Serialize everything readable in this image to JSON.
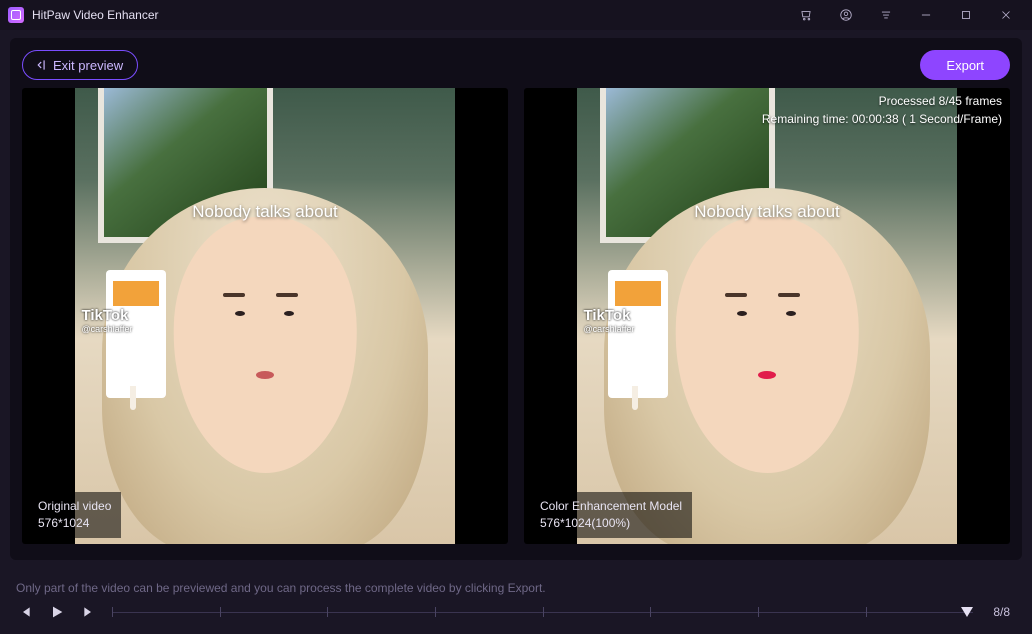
{
  "app": {
    "title": "HitPaw Video Enhancer"
  },
  "toolbar": {
    "exit_label": "Exit preview",
    "export_label": "Export"
  },
  "panes": {
    "caption": "Nobody talks about",
    "watermark": {
      "brand": "TikTok",
      "handle": "@carshlaffer"
    },
    "left": {
      "title": "Original video",
      "resolution": "576*1024"
    },
    "right": {
      "title": "Color Enhancement Model",
      "resolution": "576*1024(100%)",
      "status_line1": "Processed 8/45 frames",
      "status_line2": "Remaining time: 00:00:38 ( 1 Second/Frame)"
    }
  },
  "footer": {
    "hint": "Only part of the video can be previewed and you can process the complete video by clicking Export.",
    "counter": "8/8"
  }
}
